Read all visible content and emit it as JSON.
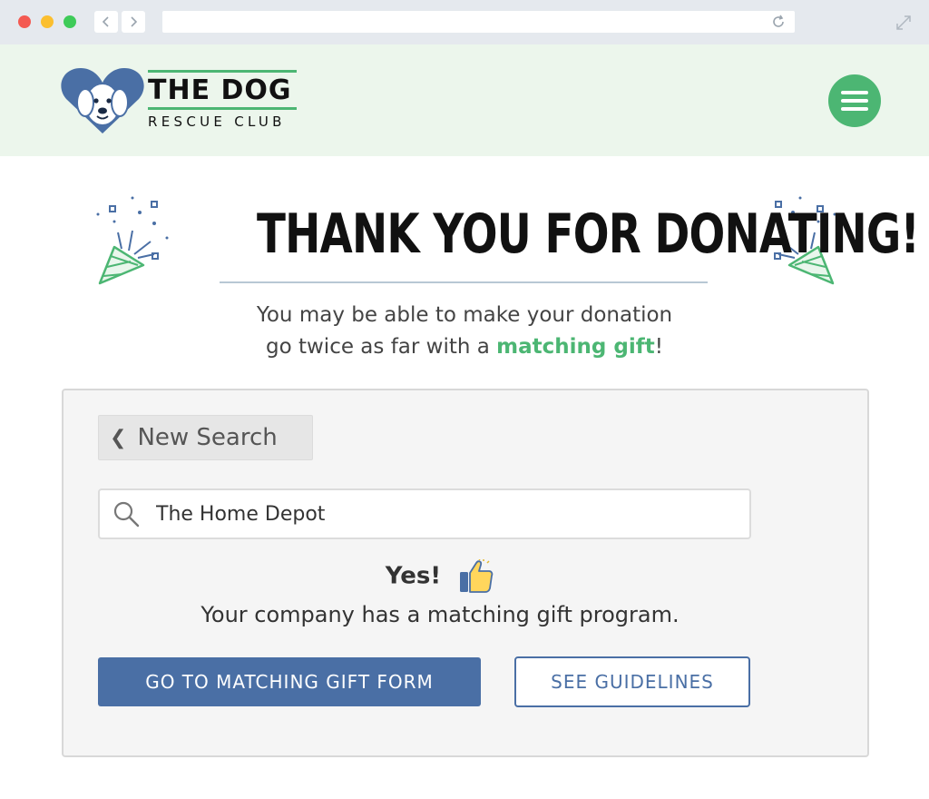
{
  "browser": {
    "address": "",
    "icons": {
      "back": "chevron-left-icon",
      "forward": "chevron-right-icon",
      "reload": "reload-icon",
      "expand": "expand-icon"
    }
  },
  "header": {
    "logo_title": "THE DOG",
    "logo_subtitle": "RESCUE CLUB",
    "menu_icon": "hamburger-menu-icon"
  },
  "colors": {
    "brand_green": "#4cb673",
    "brand_blue": "#4a6fa5",
    "header_bg": "#ecf6ec"
  },
  "main": {
    "headline": "THANK YOU FOR DONATING!",
    "subtext_line1": "You may be able to make your donation",
    "subtext_line2_before": "go twice as far with a ",
    "subtext_highlight": "matching gift",
    "subtext_line2_after": "!"
  },
  "card": {
    "new_search_label": "New Search",
    "search_value": "The Home Depot",
    "yes_label": "Yes!",
    "result_text": "Your company has a matching gift program.",
    "primary_button": "GO TO MATCHING GIFT FORM",
    "secondary_button": "SEE GUIDELINES"
  }
}
